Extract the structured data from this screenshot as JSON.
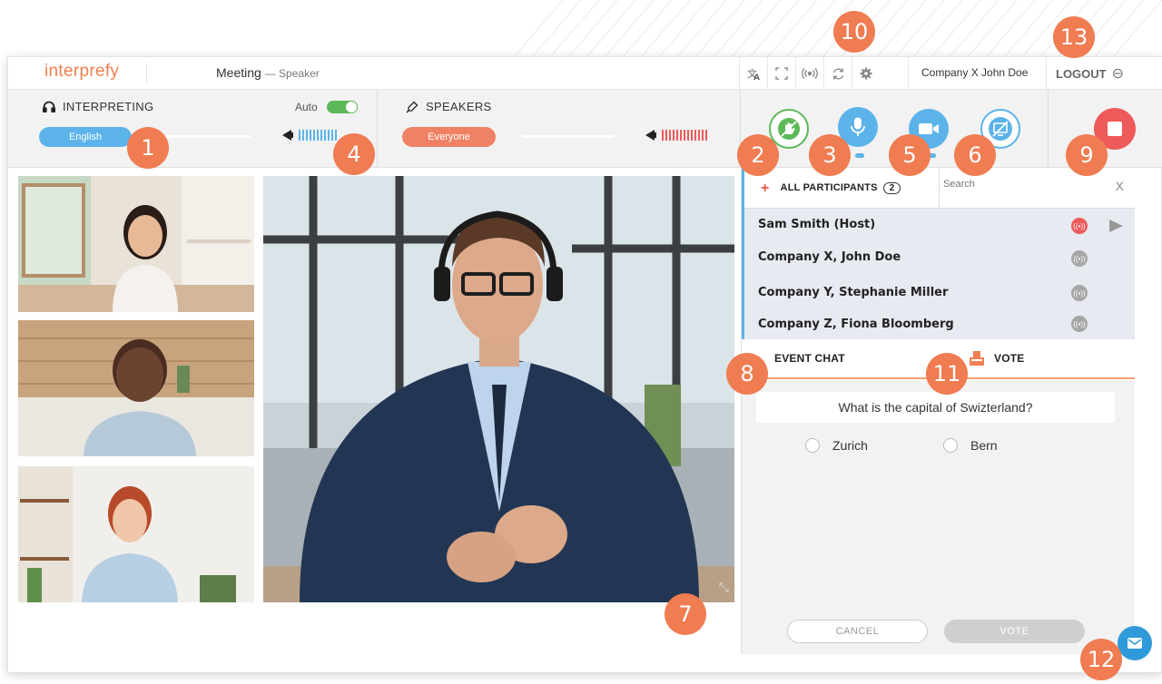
{
  "topbar": {
    "logo": "interprefy",
    "meeting_title": "Meeting",
    "meeting_role": "— Speaker",
    "icons": [
      "translate-icon",
      "fullscreen-icon",
      "broadcast-icon",
      "refresh-icon",
      "settings-icon"
    ],
    "user": "Company X John Doe",
    "logout": "LOGOUT"
  },
  "interpreting": {
    "label": "INTERPRETING",
    "language": "English",
    "auto_label": "Auto",
    "auto_on": true
  },
  "speakers": {
    "label": "SPEAKERS",
    "selection": "Everyone"
  },
  "actions": [
    "raise-hand",
    "microphone",
    "camera",
    "screen-share"
  ],
  "panel": {
    "tab_all": "ALL PARTICIPANTS",
    "count": "2",
    "search_placeholder": "Search",
    "close": "X",
    "participants": [
      {
        "name": "Sam Smith (Host)",
        "active": true
      },
      {
        "name": "Company X, John Doe",
        "active": false
      },
      {
        "name": "Company Y, Stephanie Miller",
        "active": false
      },
      {
        "name": "Company Z, Fiona Bloomberg",
        "active": false
      }
    ],
    "tab_chat": "EVENT CHAT",
    "tab_vote": "VOTE",
    "question": "What is the capital of Swizterland?",
    "options": [
      "Zurich",
      "Bern"
    ],
    "cancel": "CANCEL",
    "vote": "VOTE"
  },
  "callouts": [
    "1",
    "2",
    "3",
    "4",
    "5",
    "6",
    "7",
    "8",
    "9",
    "10",
    "11",
    "12",
    "13"
  ],
  "colors": {
    "accent_orange": "#f07c52",
    "blue": "#5cb3ea",
    "red": "#ee5a5a",
    "green": "#5db85a"
  }
}
